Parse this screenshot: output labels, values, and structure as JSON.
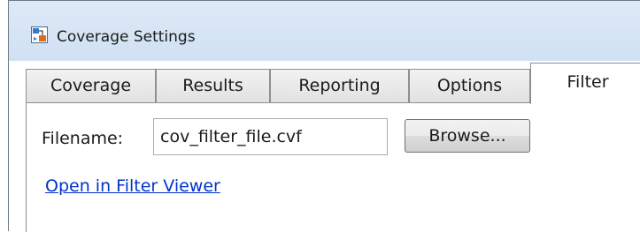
{
  "window": {
    "title": "Coverage Settings",
    "icon": "simulink-model-icon"
  },
  "tabs": [
    {
      "label": "Coverage",
      "active": false
    },
    {
      "label": "Results",
      "active": false
    },
    {
      "label": "Reporting",
      "active": false
    },
    {
      "label": "Options",
      "active": false
    },
    {
      "label": "Filter",
      "active": true
    }
  ],
  "filter": {
    "filename_label": "Filename:",
    "filename_value": "cov_filter_file.cvf",
    "browse_label": "Browse...",
    "open_link": "Open in Filter Viewer"
  }
}
